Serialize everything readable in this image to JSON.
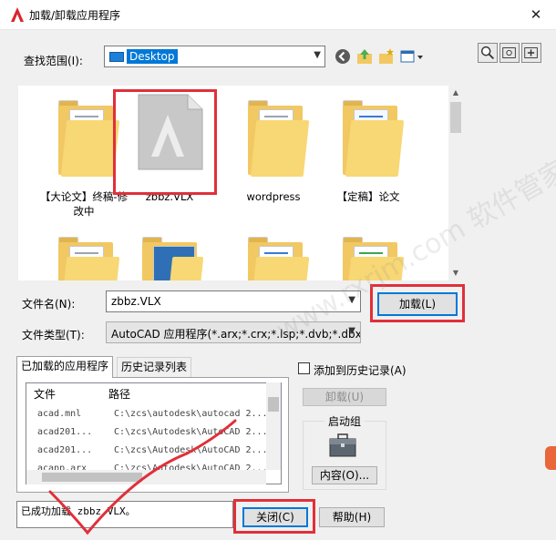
{
  "window": {
    "title": "加载/卸载应用程序",
    "close_glyph": "✕"
  },
  "lookin": {
    "label": "查找范围(I):",
    "value": "Desktop"
  },
  "files": [
    {
      "name": "【大论文】终稿-修改中",
      "type": "folder"
    },
    {
      "name": "zbbz.VLX",
      "type": "autocad-file",
      "selected": true
    },
    {
      "name": "wordpress",
      "type": "folder"
    },
    {
      "name": "【定稿】论文",
      "type": "folder"
    },
    {
      "name": "",
      "type": "folder"
    },
    {
      "name": "",
      "type": "folder-image"
    },
    {
      "name": "",
      "type": "folder"
    },
    {
      "name": "",
      "type": "folder"
    }
  ],
  "filename": {
    "label": "文件名(N):",
    "value": "zbbz.VLX"
  },
  "filetype": {
    "label": "文件类型(T):",
    "value": "AutoCAD 应用程序(*.arx;*.crx;*.lsp;*.dvb;*.dbx"
  },
  "buttons": {
    "load": "加载(L)",
    "unload": "卸载(U)",
    "contents": "内容(O)...",
    "close": "关闭(C)",
    "help": "帮助(H)"
  },
  "tabs": {
    "loaded_apps": "已加载的应用程序",
    "history": "历史记录列表"
  },
  "loaded_list": {
    "columns": [
      "文件",
      "路径"
    ],
    "rows": [
      {
        "file": "acad.mnl",
        "path": "C:\\zcs\\autodesk\\autocad 2..."
      },
      {
        "file": "acad201...",
        "path": "C:\\zcs\\Autodesk\\AutoCAD 2..."
      },
      {
        "file": "acad201...",
        "path": "C:\\zcs\\Autodesk\\AutoCAD 2..."
      },
      {
        "file": "acapp.arx",
        "path": "C:\\zcs\\Autodesk\\AutoCAD 2..."
      }
    ]
  },
  "add_history": {
    "label": "添加到历史记录(A)"
  },
  "startup_group": {
    "title": "启动组"
  },
  "status": {
    "text": "已成功加载 zbbz.VLX。"
  },
  "watermark": {
    "text": "www.rxrjm.com  软件管家"
  },
  "colors": {
    "annotation": "#e0303a",
    "selection": "#0078d7",
    "folder": "#f8d775"
  },
  "icons": [
    "autocad-logo-icon",
    "back-icon",
    "up-folder-icon",
    "new-folder-icon",
    "views-menu-icon",
    "find-icon",
    "locate-icon",
    "add-favorite-icon",
    "desktop-icon",
    "briefcase-icon"
  ]
}
